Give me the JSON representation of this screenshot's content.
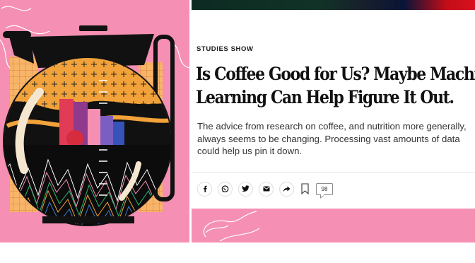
{
  "article": {
    "kicker": "STUDIES SHOW",
    "headline_line1": "Is Coffee Good for Us? Maybe Machine",
    "headline_line2": "Learning Can Help Figure It Out.",
    "dek": "The advice from research on coffee, and nutrition more generally, always seems to be changing. Processing vast amounts of data could help us pin it down."
  },
  "share": {
    "buttons": [
      {
        "icon": "facebook-icon"
      },
      {
        "icon": "whatsapp-icon"
      },
      {
        "icon": "twitter-icon"
      },
      {
        "icon": "email-icon"
      },
      {
        "icon": "share-arrow-icon"
      }
    ],
    "bookmark_icon": "bookmark-icon",
    "comment_count": "98"
  },
  "colors": {
    "pink_background": "#f58fb3",
    "pot_black": "#111111",
    "orange": "#f2a23a",
    "headline": "#111111",
    "dek": "#333333"
  }
}
